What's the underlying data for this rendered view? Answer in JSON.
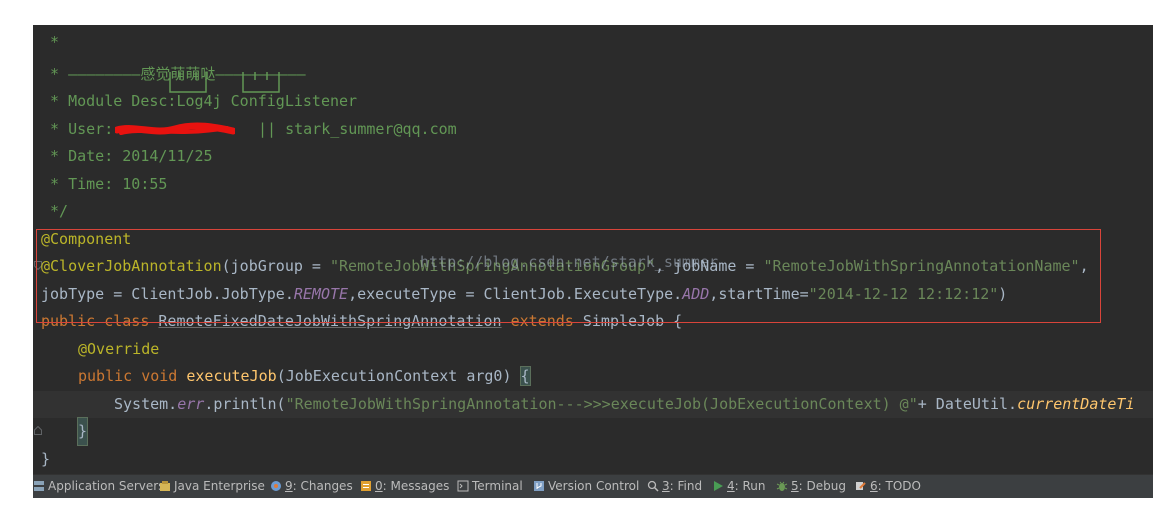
{
  "editor": {
    "comment_lines": [
      " *",
      " * ————————感觉萌萌哒——————————",
      " * Module Desc:Log4j ConfigListener",
      " * User:",
      "|| stark_summer@qq.com",
      " * Date: 2014/11/25",
      " * Time: 10:55",
      " */"
    ],
    "annotation_component": "@Component",
    "annotation_clover": "@CloverJobAnnotation",
    "anno_args_open": "(jobGroup = ",
    "job_group_value": "\"RemoteJobWithSpringAnnotationGroup\"",
    "anno_sep1": ", jobName = ",
    "job_name_value": "\"RemoteJobWithSpringAnnotationName\"",
    "anno_sep2": ",",
    "line3_a": "jobType = ClientJob.JobType.",
    "job_type_value": "REMOTE",
    "line3_b": ",executeType = ClientJob.ExecuteType.",
    "execute_type_value": "ADD",
    "line3_c": ",startTime=",
    "start_time_value": "\"2014-12-12 12:12:12\"",
    "line3_d": ")",
    "kw_public": "public",
    "kw_class": "class",
    "class_name": "RemoteFixedDateJobWithSpringAnnotation",
    "kw_extends": "extends",
    "super_class": "SimpleJob",
    "brace_open": "{",
    "annotation_override": "@Override",
    "kw_void": "void",
    "method_name": "executeJob",
    "method_params": "(JobExecutionContext arg0) ",
    "method_brace_open": "{",
    "stmt_system": "System.",
    "stmt_err": "err",
    "stmt_println": ".println(",
    "stmt_string": "\"RemoteJobWithSpringAnnotation--->>>executeJob(JobExecutionContext) @\"",
    "stmt_plus": "+ DateUtil.",
    "stmt_static_call": "currentDateTi",
    "method_brace_close": "}",
    "class_brace_close": "}",
    "watermark": "http://blog.csdn.net/stark_summer"
  },
  "tool_windows": [
    {
      "label": "Application Servers",
      "icon": "server-icon",
      "mnemonic": "",
      "rest": "Application Servers"
    },
    {
      "label": "Java Enterprise",
      "icon": "java-enterprise-icon",
      "mnemonic": "",
      "rest": "Java Enterprise"
    },
    {
      "label": "9: Changes",
      "icon": "changes-icon",
      "mnemonic": "9",
      "rest": ": Changes"
    },
    {
      "label": "0: Messages",
      "icon": "messages-icon",
      "mnemonic": "0",
      "rest": ": Messages"
    },
    {
      "label": "Terminal",
      "icon": "terminal-icon",
      "mnemonic": "",
      "rest": "Terminal"
    },
    {
      "label": "Version Control",
      "icon": "version-control-icon",
      "mnemonic": "",
      "rest": "Version Control"
    },
    {
      "label": "3: Find",
      "icon": "search-icon",
      "mnemonic": "3",
      "rest": ": Find"
    },
    {
      "label": "4: Run",
      "icon": "run-icon",
      "mnemonic": "4",
      "rest": ": Run"
    },
    {
      "label": "5: Debug",
      "icon": "debug-icon",
      "mnemonic": "5",
      "rest": ": Debug"
    },
    {
      "label": "6: TODO",
      "icon": "todo-icon",
      "mnemonic": "6",
      "rest": ": TODO"
    }
  ],
  "colors": {
    "editor_bg": "#2b2b2b",
    "comment": "#629755",
    "keyword": "#cc7832",
    "string": "#6a8759",
    "annotation": "#bbb529",
    "field": "#9876aa",
    "method": "#ffc66d",
    "selection_box": "#d9443a",
    "statusbar_bg": "#3c3f41"
  }
}
